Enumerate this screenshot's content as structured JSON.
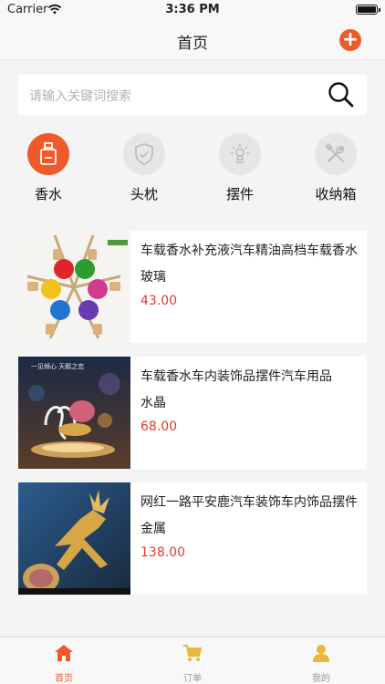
{
  "status_bar": {
    "carrier": "Carrier",
    "time": "3:36 PM"
  },
  "nav": {
    "title": "首页",
    "add_label": "+"
  },
  "search": {
    "placeholder": "请输入关键词搜索"
  },
  "categories": [
    {
      "label": "香水",
      "icon": "perfume-bottle-icon",
      "active": true
    },
    {
      "label": "头枕",
      "icon": "shield-check-icon",
      "active": false
    },
    {
      "label": "摆件",
      "icon": "ornament-icon",
      "active": false
    },
    {
      "label": "收纳箱",
      "icon": "tools-icon",
      "active": false
    }
  ],
  "products": [
    {
      "name": "车载香水补充液汽车精油高档车载香水",
      "material": "玻璃",
      "price": "43.00",
      "image": "colorful-perfume-bottles"
    },
    {
      "name": "车载香水车内装饰品摆件汽车用品",
      "material": "水晶",
      "price": "68.00",
      "image": "crystal-swan-ornament",
      "image_caption": "一见倾心  天鹅之恋"
    },
    {
      "name": "网红一路平安鹿汽车装饰车内饰品摆件",
      "material": "金属",
      "price": "138.00",
      "image": "golden-deer-ornament"
    }
  ],
  "tabs": [
    {
      "label": "首页",
      "icon": "home-icon",
      "active": true
    },
    {
      "label": "订单",
      "icon": "cart-icon",
      "active": false
    },
    {
      "label": "我的",
      "icon": "user-icon",
      "active": false
    }
  ],
  "colors": {
    "accent": "#f05a2a",
    "price": "#e23b2e",
    "inactive_icon": "#e8b83a"
  }
}
